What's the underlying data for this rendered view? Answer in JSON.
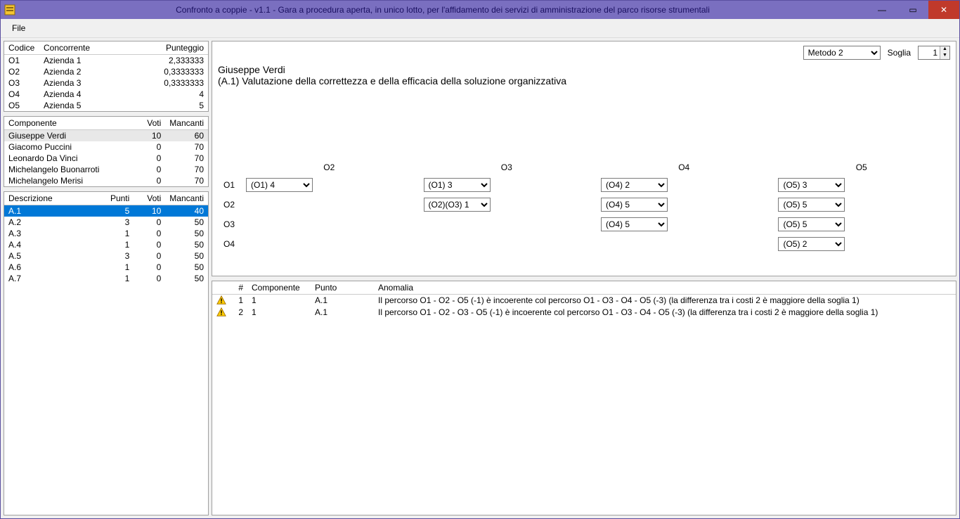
{
  "title": "Confronto a coppie - v1.1 - Gara a procedura aperta, in unico lotto, per l'affidamento dei servizi di amministrazione del parco risorse strumentali",
  "menu": {
    "file": "File"
  },
  "win": {
    "min": "—",
    "max": "▭",
    "close": "✕"
  },
  "score_table": {
    "headers": {
      "code": "Codice",
      "comp": "Concorrente",
      "score": "Punteggio"
    },
    "rows": [
      {
        "code": "O1",
        "comp": "Azienda 1",
        "score": "2,333333"
      },
      {
        "code": "O2",
        "comp": "Azienda 2",
        "score": "0,3333333"
      },
      {
        "code": "O3",
        "comp": "Azienda 3",
        "score": "0,3333333"
      },
      {
        "code": "O4",
        "comp": "Azienda 4",
        "score": "4"
      },
      {
        "code": "O5",
        "comp": "Azienda 5",
        "score": "5"
      }
    ]
  },
  "component_table": {
    "headers": {
      "name": "Componente",
      "votes": "Voti",
      "missing": "Mancanti"
    },
    "rows": [
      {
        "name": "Giuseppe Verdi",
        "votes": "10",
        "missing": "60",
        "sel": true
      },
      {
        "name": "Giacomo Puccini",
        "votes": "0",
        "missing": "70"
      },
      {
        "name": "Leonardo Da Vinci",
        "votes": "0",
        "missing": "70"
      },
      {
        "name": "Michelangelo Buonarroti",
        "votes": "0",
        "missing": "70"
      },
      {
        "name": "Michelangelo Merisi",
        "votes": "0",
        "missing": "70"
      }
    ]
  },
  "desc_table": {
    "headers": {
      "d": "Descrizione",
      "p": "Punti",
      "v": "Voti",
      "m": "Mancanti"
    },
    "rows": [
      {
        "d": "A.1",
        "p": "5",
        "v": "10",
        "m": "40",
        "sel": true
      },
      {
        "d": "A.2",
        "p": "3",
        "v": "0",
        "m": "50"
      },
      {
        "d": "A.3",
        "p": "1",
        "v": "0",
        "m": "50"
      },
      {
        "d": "A.4",
        "p": "1",
        "v": "0",
        "m": "50"
      },
      {
        "d": "A.5",
        "p": "3",
        "v": "0",
        "m": "50"
      },
      {
        "d": "A.6",
        "p": "1",
        "v": "0",
        "m": "50"
      },
      {
        "d": "A.7",
        "p": "1",
        "v": "0",
        "m": "50"
      }
    ]
  },
  "controls": {
    "method_value": "Metodo 2",
    "soglia_label": "Soglia",
    "soglia_value": "1"
  },
  "heading": {
    "person": "Giuseppe Verdi",
    "criterion": "(A.1) Valutazione della correttezza e della efficacia della soluzione organizzativa"
  },
  "matrix": {
    "cols": [
      "O2",
      "O3",
      "O4",
      "O5"
    ],
    "rows": [
      "O1",
      "O2",
      "O3",
      "O4"
    ],
    "cells": {
      "O1_O2": "(O1) 4",
      "O1_O3": "(O1) 3",
      "O1_O4": "(O4) 2",
      "O1_O5": "(O5) 3",
      "O2_O3": "(O2)(O3) 1",
      "O2_O4": "(O4) 5",
      "O2_O5": "(O5) 5",
      "O3_O4": "(O4) 5",
      "O3_O5": "(O5) 5",
      "O4_O5": "(O5) 2"
    }
  },
  "anomaly_table": {
    "headers": {
      "num": "#",
      "comp": "Componente",
      "punto": "Punto",
      "anom": "Anomalia"
    },
    "rows": [
      {
        "num": "1",
        "comp": "1",
        "punto": "A.1",
        "anom": "Il percorso O1 - O2 - O5 (-1) è incoerente col percorso O1 - O3 - O4 - O5 (-3) (la differenza tra i costi 2 è maggiore della soglia 1)"
      },
      {
        "num": "2",
        "comp": "1",
        "punto": "A.1",
        "anom": "Il percorso O1 - O2 - O3 - O5 (-1) è incoerente col percorso O1 - O3 - O4 - O5 (-3) (la differenza tra i costi 2 è maggiore della soglia 1)"
      }
    ]
  }
}
